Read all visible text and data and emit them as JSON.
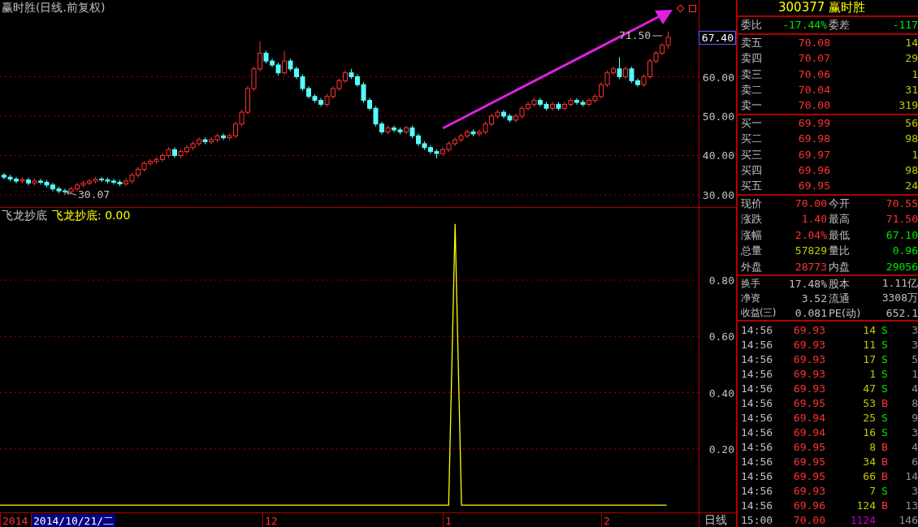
{
  "price_chart": {
    "title": "赢时胜(日线.前复权)",
    "high_label": "71.50",
    "low_label": "30.07",
    "current_price": "67.40",
    "chart_data": {
      "type": "candlestick",
      "grid": true,
      "ylim": [
        26.9,
        79.5
      ],
      "yticks": [
        {
          "value": 60,
          "label": "60.00"
        },
        {
          "value": 50,
          "label": "50.00"
        },
        {
          "value": 40,
          "label": "40.00"
        },
        {
          "value": 30,
          "label": "30.00"
        }
      ],
      "ohlc": [
        [
          35,
          35.6,
          33.9,
          34.5
        ],
        [
          34.5,
          35.1,
          33.4,
          34
        ],
        [
          34,
          34.6,
          32.9,
          33.5
        ],
        [
          33.5,
          34.4,
          32.9,
          33.8
        ],
        [
          33.8,
          34.4,
          32.4,
          33
        ],
        [
          33,
          34.1,
          32.4,
          33.5
        ],
        [
          33.5,
          34.1,
          32.6,
          33.2
        ],
        [
          33.2,
          33.8,
          31.9,
          32.5
        ],
        [
          32.5,
          33.1,
          30.9,
          31.5
        ],
        [
          31.5,
          32.1,
          30.4,
          31
        ],
        [
          31,
          31.6,
          30.07,
          30.8
        ],
        [
          30.8,
          32.1,
          30.2,
          31.5
        ],
        [
          31.5,
          33.1,
          30.9,
          32.5
        ],
        [
          32.5,
          33.6,
          31.9,
          33
        ],
        [
          33,
          34.1,
          32.4,
          33.5
        ],
        [
          33.5,
          34.6,
          32.9,
          34
        ],
        [
          34,
          34.6,
          33.2,
          33.8
        ],
        [
          33.8,
          34.4,
          32.9,
          33.5
        ],
        [
          33.5,
          34.1,
          32.6,
          33.2
        ],
        [
          33.2,
          33.8,
          32.2,
          32.8
        ],
        [
          32.8,
          34.1,
          32.2,
          33.5
        ],
        [
          33.5,
          35.6,
          32.9,
          35
        ],
        [
          35,
          37.1,
          34.4,
          36.5
        ],
        [
          36.5,
          38.6,
          35.9,
          38
        ],
        [
          38,
          39.1,
          37.4,
          38.5
        ],
        [
          38.5,
          39.6,
          37.9,
          39
        ],
        [
          39,
          40.6,
          38.4,
          40
        ],
        [
          40,
          42.1,
          39.4,
          41.5
        ],
        [
          41.5,
          42.1,
          39.4,
          40
        ],
        [
          40,
          41.6,
          39.4,
          41
        ],
        [
          41,
          42.6,
          40.4,
          42
        ],
        [
          42,
          43.6,
          41.4,
          43
        ],
        [
          43,
          44.6,
          42.4,
          44
        ],
        [
          44,
          44.6,
          42.9,
          43.5
        ],
        [
          43.5,
          44.6,
          42.9,
          44
        ],
        [
          44,
          45.6,
          43.4,
          45
        ],
        [
          45,
          45.6,
          43.9,
          44.5
        ],
        [
          44.5,
          45.6,
          43.9,
          45
        ],
        [
          45,
          48.6,
          44.4,
          48
        ],
        [
          48,
          51.6,
          47.4,
          51
        ],
        [
          51,
          57.6,
          50.4,
          57
        ],
        [
          57,
          62.6,
          56.4,
          62
        ],
        [
          62,
          69,
          61.4,
          66
        ],
        [
          66,
          66.6,
          63.4,
          64
        ],
        [
          64,
          64.6,
          62.4,
          63
        ],
        [
          63,
          63.6,
          60.4,
          61
        ],
        [
          61,
          66.6,
          60.4,
          64
        ],
        [
          64,
          64.6,
          61.4,
          62
        ],
        [
          62,
          62.6,
          59.4,
          60
        ],
        [
          60,
          60.6,
          56.4,
          57
        ],
        [
          57,
          57.6,
          54.4,
          55
        ],
        [
          55,
          55.6,
          53.4,
          54
        ],
        [
          54,
          54.6,
          52.4,
          53
        ],
        [
          53,
          55.6,
          52.4,
          55
        ],
        [
          55,
          57.6,
          54.4,
          57
        ],
        [
          57,
          59.6,
          56.4,
          59
        ],
        [
          59,
          61.6,
          58.4,
          61
        ],
        [
          61,
          62,
          59.4,
          60
        ],
        [
          60,
          60.6,
          57.4,
          58
        ],
        [
          58,
          58.6,
          53.4,
          54
        ],
        [
          54,
          54.6,
          51.4,
          52
        ],
        [
          52,
          52.6,
          47.4,
          48
        ],
        [
          48,
          48.6,
          45.4,
          46
        ],
        [
          46,
          47.6,
          45.4,
          47
        ],
        [
          47,
          47.6,
          45.9,
          46.5
        ],
        [
          46.5,
          47.1,
          45.4,
          46
        ],
        [
          46,
          47.6,
          45.4,
          47
        ],
        [
          47,
          47.6,
          44.4,
          45
        ],
        [
          45,
          45.6,
          42.4,
          43
        ],
        [
          43,
          43.6,
          41.4,
          42
        ],
        [
          42,
          42.6,
          40.4,
          41
        ],
        [
          41,
          41.6,
          39.2,
          40.5
        ],
        [
          40.5,
          42.1,
          39.9,
          41.5
        ],
        [
          41.5,
          43.6,
          40.9,
          43
        ],
        [
          43,
          44.6,
          42.4,
          44
        ],
        [
          44,
          45.6,
          43.4,
          45
        ],
        [
          45,
          46.6,
          44.4,
          46
        ],
        [
          46,
          46.6,
          44.9,
          45.5
        ],
        [
          45.5,
          46.6,
          44.9,
          46
        ],
        [
          46,
          48.6,
          45.4,
          48
        ],
        [
          48,
          50.6,
          47.4,
          50
        ],
        [
          50,
          51.6,
          49.4,
          51
        ],
        [
          51,
          51.6,
          49.4,
          50
        ],
        [
          50,
          50.6,
          48.4,
          49
        ],
        [
          49,
          50.6,
          48.4,
          50
        ],
        [
          50,
          52.6,
          49.4,
          52
        ],
        [
          52,
          53.6,
          51.4,
          53
        ],
        [
          53,
          54.6,
          52.4,
          54
        ],
        [
          54,
          54.6,
          52.4,
          53
        ],
        [
          53,
          53.6,
          51.4,
          52
        ],
        [
          52,
          53.6,
          51.4,
          53
        ],
        [
          53,
          53.6,
          51.4,
          52
        ],
        [
          52,
          53.6,
          51.4,
          53
        ],
        [
          53,
          54.6,
          52.4,
          54
        ],
        [
          54,
          54.6,
          52.9,
          53.5
        ],
        [
          53.5,
          54.1,
          52.4,
          53
        ],
        [
          53,
          54.6,
          52.4,
          54
        ],
        [
          54,
          55.6,
          53.4,
          55
        ],
        [
          55,
          58.6,
          54.4,
          58
        ],
        [
          58,
          61.6,
          57.4,
          61
        ],
        [
          61,
          62.6,
          60.4,
          62
        ],
        [
          62,
          65,
          59.4,
          60
        ],
        [
          60,
          62.6,
          59.4,
          62
        ],
        [
          62,
          62.6,
          58.4,
          59
        ],
        [
          59,
          59.6,
          57.4,
          58
        ],
        [
          58,
          60.6,
          57.4,
          60
        ],
        [
          60,
          64.6,
          59.4,
          64
        ],
        [
          64,
          66.6,
          63.4,
          66
        ],
        [
          66,
          68.6,
          65.4,
          68
        ],
        [
          68,
          71.5,
          67.1,
          70
        ]
      ]
    }
  },
  "indicator": {
    "title": "飞龙抄底",
    "legend": "飞龙抄底: 0.00",
    "chart_data": {
      "type": "line",
      "grid": true,
      "ylim": [
        -0.075,
        1.057
      ],
      "yticks": [
        {
          "value": 0.8,
          "label": "0.80"
        },
        {
          "value": 0.6,
          "label": "0.60"
        },
        {
          "value": 0.4,
          "label": "0.40"
        },
        {
          "value": 0.2,
          "label": "0.20"
        }
      ],
      "series": [
        {
          "color": "#ffff00",
          "values": [
            0,
            0,
            0,
            0,
            0,
            0,
            0,
            0,
            0,
            0,
            0,
            0,
            0,
            0,
            0,
            0,
            0,
            0,
            0,
            0,
            0,
            0,
            0,
            0,
            0,
            0,
            0,
            0,
            0,
            0,
            0,
            0,
            0,
            0,
            0,
            0,
            0,
            0,
            0,
            0,
            0,
            0,
            0,
            0,
            0,
            0,
            0,
            0,
            0,
            0,
            0,
            0,
            0,
            0,
            0,
            0,
            0,
            0,
            0,
            0,
            0,
            0,
            0,
            0,
            0,
            0,
            0,
            0,
            0,
            0,
            0,
            1.0,
            0,
            0,
            0,
            0,
            0,
            0,
            0,
            0,
            0,
            0,
            0,
            0,
            0,
            0,
            0,
            0,
            0,
            0,
            0,
            0,
            0,
            0,
            0,
            0,
            0,
            0,
            0,
            0,
            0,
            0,
            0,
            0,
            0,
            null,
            null,
            null,
            null,
            null
          ]
        }
      ]
    }
  },
  "date_axis": {
    "labels": [
      {
        "text": "2014",
        "selected": false
      },
      {
        "text": "2014/10/21/二",
        "selected": true
      },
      {
        "text": "12",
        "selected": false
      },
      {
        "text": "1",
        "selected": false
      },
      {
        "text": "2",
        "selected": false
      }
    ],
    "period": "日线"
  },
  "quote_panel": {
    "title": "300377 赢时胜",
    "order_ratio": [
      {
        "label": "委比",
        "value": "-17.44%",
        "color": "#00e600"
      },
      {
        "label": "委差",
        "value": "-117",
        "color": "#00e600"
      }
    ],
    "asks": [
      {
        "label": "卖五",
        "price": "70.08",
        "volume": "14"
      },
      {
        "label": "卖四",
        "price": "70.07",
        "volume": "29"
      },
      {
        "label": "卖三",
        "price": "70.06",
        "volume": "1"
      },
      {
        "label": "卖二",
        "price": "70.04",
        "volume": "31"
      },
      {
        "label": "卖一",
        "price": "70.00",
        "volume": "319"
      }
    ],
    "bids": [
      {
        "label": "买一",
        "price": "69.99",
        "volume": "56"
      },
      {
        "label": "买二",
        "price": "69.98",
        "volume": "98"
      },
      {
        "label": "买三",
        "price": "69.97",
        "volume": "1"
      },
      {
        "label": "买四",
        "price": "69.96",
        "volume": "98"
      },
      {
        "label": "买五",
        "price": "69.95",
        "volume": "24"
      }
    ],
    "stats": [
      {
        "label": "现价",
        "value": "70.00",
        "color": "#ff3232"
      },
      {
        "label": "今开",
        "value": "70.55",
        "color": "#ff3232"
      },
      {
        "label": "涨跌",
        "value": "1.40",
        "color": "#ff3232"
      },
      {
        "label": "最高",
        "value": "71.50",
        "color": "#ff3232"
      },
      {
        "label": "涨幅",
        "value": "2.04%",
        "color": "#ff3232"
      },
      {
        "label": "最低",
        "value": "67.10",
        "color": "#00e600"
      },
      {
        "label": "总量",
        "value": "57829",
        "color": "#c8c800"
      },
      {
        "label": "量比",
        "value": "0.96",
        "color": "#00e600"
      },
      {
        "label": "外盘",
        "value": "28773",
        "color": "#ff3232"
      },
      {
        "label": "内盘",
        "value": "29056",
        "color": "#00e600"
      }
    ],
    "fundamentals": [
      "换手",
      "17.48%",
      "股本",
      "1.11亿",
      "净资",
      "3.52",
      "流通",
      "3308万",
      "收益(三)",
      "0.081",
      "PE(动)",
      "652.1"
    ],
    "trades": [
      {
        "kind": "tick",
        "time": "14:56",
        "price": "69.93",
        "volume": "14",
        "side": "S",
        "color": "#00e600",
        "count": "3"
      },
      {
        "kind": "tick",
        "time": "14:56",
        "price": "69.93",
        "volume": "11",
        "side": "S",
        "color": "#00e600",
        "count": "3"
      },
      {
        "kind": "tick",
        "time": "14:56",
        "price": "69.93",
        "volume": "17",
        "side": "S",
        "color": "#00e600",
        "count": "5"
      },
      {
        "kind": "tick",
        "time": "14:56",
        "price": "69.93",
        "volume": "1",
        "side": "S",
        "color": "#00e600",
        "count": "1"
      },
      {
        "kind": "tick",
        "time": "14:56",
        "price": "69.93",
        "volume": "47",
        "side": "S",
        "color": "#00e600",
        "count": "4"
      },
      {
        "kind": "tick",
        "time": "14:56",
        "price": "69.95",
        "volume": "53",
        "side": "B",
        "color": "#ff3232",
        "count": "8"
      },
      {
        "kind": "tick",
        "time": "14:56",
        "price": "69.94",
        "volume": "25",
        "side": "S",
        "color": "#00e600",
        "count": "9"
      },
      {
        "kind": "tick",
        "time": "14:56",
        "price": "69.94",
        "volume": "16",
        "side": "S",
        "color": "#00e600",
        "count": "3"
      },
      {
        "kind": "tick",
        "time": "14:56",
        "price": "69.95",
        "volume": "8",
        "side": "B",
        "color": "#ff3232",
        "count": "4"
      },
      {
        "kind": "tick",
        "time": "14:56",
        "price": "69.95",
        "volume": "34",
        "side": "B",
        "color": "#ff3232",
        "count": "6"
      },
      {
        "kind": "tick",
        "time": "14:56",
        "price": "69.95",
        "volume": "66",
        "side": "B",
        "color": "#ff3232",
        "count": "14"
      },
      {
        "kind": "tick",
        "time": "14:56",
        "price": "69.93",
        "volume": "7",
        "side": "S",
        "color": "#00e600",
        "count": "3"
      },
      {
        "kind": "tick",
        "time": "14:56",
        "price": "69.96",
        "volume": "124",
        "side": "B",
        "color": "#ff3232",
        "count": "13"
      },
      {
        "kind": "close",
        "time": "15:00",
        "price": "70.00",
        "volume": "1124",
        "count": "146"
      }
    ]
  }
}
